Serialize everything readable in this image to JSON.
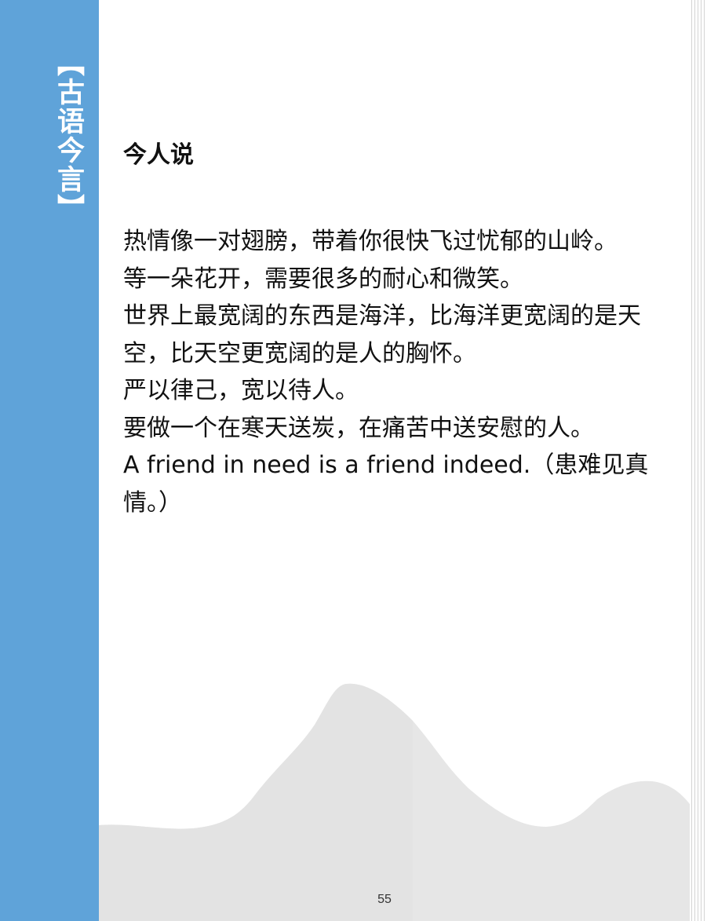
{
  "sidebar": {
    "tag": "【古语今言】",
    "color": "#5fa3d9"
  },
  "content": {
    "heading": "今人说",
    "lines": [
      "热情像一对翅膀，带着你很快飞过忧郁的山岭。",
      "等一朵花开，需要很多的耐心和微笑。",
      "世界上最宽阔的东西是海洋，比海洋更宽阔的是天空，比天空更宽阔的是人的胸怀。",
      "严以律己，宽以待人。",
      "要做一个在寒天送炭，在痛苦中送安慰的人。",
      "A friend in need is a friend indeed.（患难见真情。）"
    ]
  },
  "footer": {
    "page_number": "55"
  }
}
